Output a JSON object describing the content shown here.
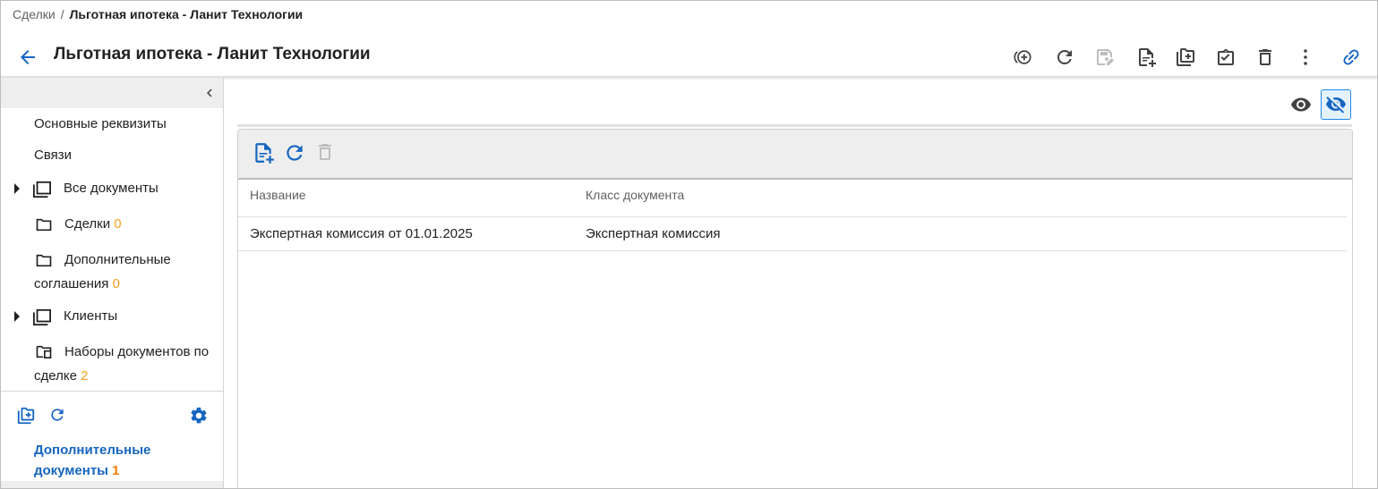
{
  "breadcrumb": {
    "parent": "Сделки",
    "separator": "/",
    "current": "Льготная ипотека - Ланит Технологии"
  },
  "page_title": "Льготная ипотека - Ланит Технологии",
  "toolbar": {
    "icons": [
      "add-circle-icon",
      "refresh-icon",
      "save-edit-icon",
      "add-document-icon",
      "add-folder-icon",
      "task-icon",
      "delete-icon",
      "more-icon",
      "link-icon"
    ],
    "accent_color": "#1565c0"
  },
  "sidebar": {
    "items": [
      {
        "label": "Основные реквизиты"
      },
      {
        "label": "Связи"
      },
      {
        "label": "Все документы"
      },
      {
        "label": "Сделки",
        "count": "0"
      },
      {
        "label": "Дополнительные",
        "label2": "соглашения",
        "count": "0"
      },
      {
        "label": "Клиенты"
      },
      {
        "label": "Наборы документов по",
        "label2": "сделке",
        "count": "2"
      }
    ],
    "active": {
      "label": "Дополнительные",
      "label2": "документы",
      "count": "1"
    }
  },
  "table": {
    "columns": [
      "Название",
      "Класс документа"
    ],
    "rows": [
      {
        "name": "Экспертная комиссия от 01.01.2025",
        "class": "Экспертная комиссия"
      }
    ]
  }
}
